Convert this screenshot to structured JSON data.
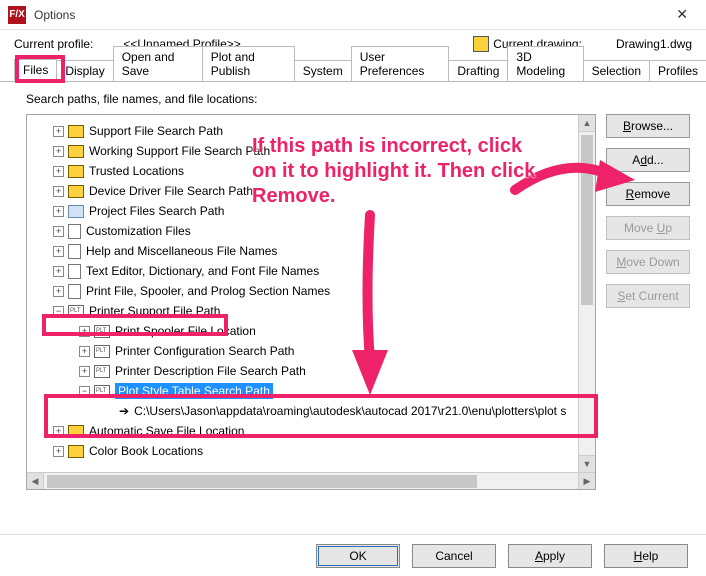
{
  "window": {
    "title": "Options"
  },
  "profile": {
    "label": "Current profile:",
    "value": "<<Unnamed Profile>>",
    "drawing_label": "Current drawing:",
    "drawing_value": "Drawing1.dwg"
  },
  "tabs": {
    "items": [
      {
        "label": "Files"
      },
      {
        "label": "Display"
      },
      {
        "label": "Open and Save"
      },
      {
        "label": "Plot and Publish"
      },
      {
        "label": "System"
      },
      {
        "label": "User Preferences"
      },
      {
        "label": "Drafting"
      },
      {
        "label": "3D Modeling"
      },
      {
        "label": "Selection"
      },
      {
        "label": "Profiles"
      }
    ],
    "active": "Files"
  },
  "tree": {
    "caption": "Search paths, file names, and file locations:",
    "nodes": {
      "support": "Support File Search Path",
      "working": "Working Support File Search Path",
      "trusted": "Trusted Locations",
      "driver": "Device Driver File Search Path",
      "project": "Project Files Search Path",
      "custom": "Customization Files",
      "helpmisc": "Help and Miscellaneous File Names",
      "textedit": "Text Editor, Dictionary, and Font File Names",
      "printspool": "Print File, Spooler, and Prolog Section Names",
      "printer_support": "Printer Support File Path",
      "print_spooler_loc": "Print Spooler File Location",
      "printer_config": "Printer Configuration Search Path",
      "printer_desc": "Printer Description File Search Path",
      "plot_style": "Plot Style Table Search Path",
      "plot_style_path": "C:\\Users\\Jason\\appdata\\roaming\\autodesk\\autocad 2017\\r21.0\\enu\\plotters\\plot s",
      "autosave": "Automatic Save File Location",
      "colorbook": "Color Book Locations"
    }
  },
  "sidebar": {
    "browse": "Browse...",
    "add": "Add...",
    "remove": "Remove",
    "moveup": "Move Up",
    "movedown": "Move Down",
    "setcurrent": "Set Current"
  },
  "buttons": {
    "ok": "OK",
    "cancel": "Cancel",
    "apply": "Apply",
    "help": "Help"
  },
  "annotation": {
    "text": "If this path is incorrect, click on it to highlight it. Then click Remove."
  }
}
